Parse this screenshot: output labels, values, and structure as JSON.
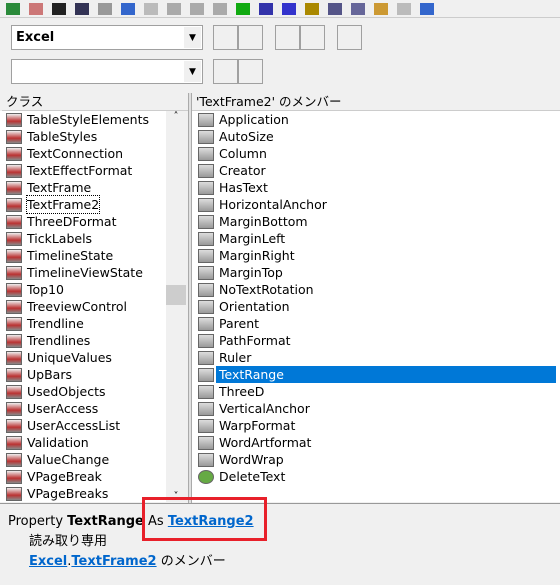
{
  "toolbar": {
    "icons": [
      "excel-icon",
      "insert-module-icon",
      "dropdown-icon",
      "save-icon",
      "cut-icon",
      "copy-icon",
      "paste-icon",
      "find-icon",
      "undo-icon",
      "redo-icon",
      "run-icon",
      "pause-icon",
      "stop-icon",
      "design-mode-icon",
      "project-explorer-icon",
      "properties-icon",
      "object-browser-icon",
      "toolbox-icon",
      "help-icon"
    ]
  },
  "library_combo": {
    "value": "Excel"
  },
  "search_combo": {
    "value": ""
  },
  "classes": {
    "header": "クラス",
    "items": [
      "TableStyleElements",
      "TableStyles",
      "TextConnection",
      "TextEffectFormat",
      "TextFrame",
      "TextFrame2",
      "ThreeDFormat",
      "TickLabels",
      "TimelineState",
      "TimelineViewState",
      "Top10",
      "TreeviewControl",
      "Trendline",
      "Trendlines",
      "UniqueValues",
      "UpBars",
      "UsedObjects",
      "UserAccess",
      "UserAccessList",
      "Validation",
      "ValueChange",
      "VPageBreak",
      "VPageBreaks"
    ],
    "focused": "TextFrame2"
  },
  "members": {
    "header": "'TextFrame2' のメンバー",
    "items": [
      "Application",
      "AutoSize",
      "Column",
      "Creator",
      "HasText",
      "HorizontalAnchor",
      "MarginBottom",
      "MarginLeft",
      "MarginRight",
      "MarginTop",
      "NoTextRotation",
      "Orientation",
      "Parent",
      "PathFormat",
      "Ruler",
      "TextRange",
      "ThreeD",
      "VerticalAnchor",
      "WarpFormat",
      "WordArtformat",
      "WordWrap",
      "DeleteText"
    ],
    "selected": "TextRange"
  },
  "details": {
    "kind": "Property",
    "name": "TextRange",
    "as": "As",
    "type_link": "TextRange2",
    "readonly": "読み取り専用",
    "lib_link": "Excel",
    "dot": ".",
    "class_link": "TextFrame2",
    "member_of": "のメンバー"
  },
  "colors": {
    "selection": "#0078d7",
    "link": "#0066cc",
    "highlight_box": "#e8202a"
  }
}
